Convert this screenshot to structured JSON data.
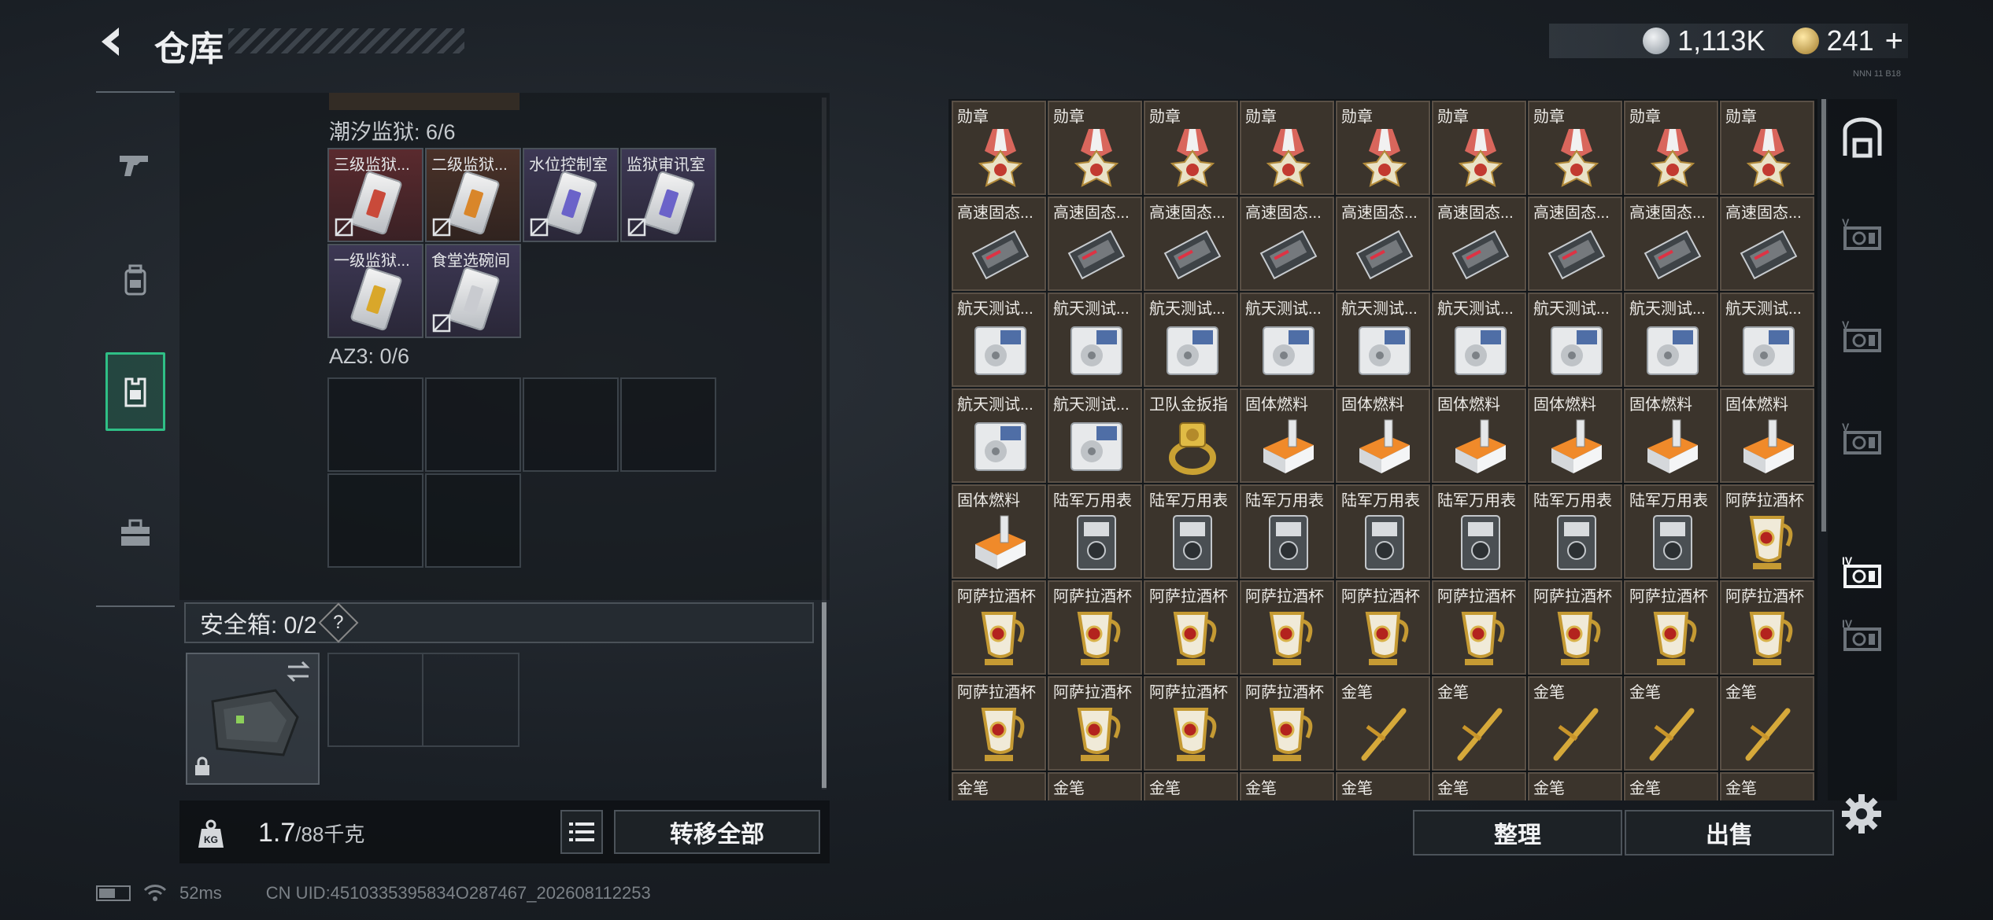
{
  "header": {
    "title": "仓库",
    "tiny_label": "NNN 11 B18"
  },
  "currency": [
    {
      "icon": "silver-coin-icon",
      "value": "1,113K"
    },
    {
      "icon": "gold-coin-icon",
      "value": "241"
    }
  ],
  "left_nav": [
    "pistol-icon",
    "backpack-icon",
    "vest-icon",
    "toolbox-icon"
  ],
  "containers": {
    "tide_prison": {
      "label": "潮汐监狱: 6/6",
      "items": [
        {
          "name": "三级监狱...",
          "rarity": "red",
          "band": "#c94a3a"
        },
        {
          "name": "二级监狱...",
          "rarity": "orange",
          "band": "#d9862a"
        },
        {
          "name": "水位控制室",
          "rarity": "purple",
          "band": "#6b63c9"
        },
        {
          "name": "监狱审讯室",
          "rarity": "purple",
          "band": "#6b63c9"
        },
        {
          "name": "一级监狱...",
          "rarity": "purple",
          "band": "#d9a72a"
        },
        {
          "name": "食堂选碗间",
          "rarity": "purple",
          "band": "#c9cbd0"
        }
      ]
    },
    "az3": {
      "label": "AZ3: 0/6"
    }
  },
  "safe_box": {
    "label": "安全箱: 0/2",
    "help": "?"
  },
  "weight": {
    "current": "1.7",
    "max": "/88千克"
  },
  "buttons": {
    "transfer_all": "转移全部",
    "sort": "整理",
    "sell": "出售"
  },
  "status": {
    "ping": "52ms",
    "uid": "CN UID:4510335395834O287467_202608112253"
  },
  "stash": {
    "rows": [
      [
        "勋章",
        "勋章",
        "勋章",
        "勋章",
        "勋章",
        "勋章",
        "勋章",
        "勋章",
        "勋章"
      ],
      [
        "高速固态...",
        "高速固态...",
        "高速固态...",
        "高速固态...",
        "高速固态...",
        "高速固态...",
        "高速固态...",
        "高速固态...",
        "高速固态..."
      ],
      [
        "航天测试...",
        "航天测试...",
        "航天测试...",
        "航天测试...",
        "航天测试...",
        "航天测试...",
        "航天测试...",
        "航天测试...",
        "航天测试..."
      ],
      [
        "航天测试...",
        "航天测试...",
        "卫队金扳指",
        "固体燃料",
        "固体燃料",
        "固体燃料",
        "固体燃料",
        "固体燃料",
        "固体燃料"
      ],
      [
        "固体燃料",
        "陆军万用表",
        "陆军万用表",
        "陆军万用表",
        "陆军万用表",
        "陆军万用表",
        "陆军万用表",
        "陆军万用表",
        "阿萨拉酒杯"
      ],
      [
        "阿萨拉酒杯",
        "阿萨拉酒杯",
        "阿萨拉酒杯",
        "阿萨拉酒杯",
        "阿萨拉酒杯",
        "阿萨拉酒杯",
        "阿萨拉酒杯",
        "阿萨拉酒杯",
        "阿萨拉酒杯"
      ],
      [
        "阿萨拉酒杯",
        "阿萨拉酒杯",
        "阿萨拉酒杯",
        "阿萨拉酒杯",
        "金笔",
        "金笔",
        "金笔",
        "金笔",
        "金笔"
      ],
      [
        "金笔",
        "金笔",
        "金笔",
        "金笔",
        "金笔",
        "金笔",
        "金笔",
        "金笔",
        "金笔"
      ]
    ]
  },
  "right_tabs": [
    "vault-icon",
    "shelf-v-icon",
    "shelf-v-icon",
    "shelf-v-icon",
    "shelf-v-active-icon",
    "shelf-iv-icon"
  ],
  "colors": {
    "accent_green": "#2fbf86",
    "slot_brown": "#3b342c"
  }
}
